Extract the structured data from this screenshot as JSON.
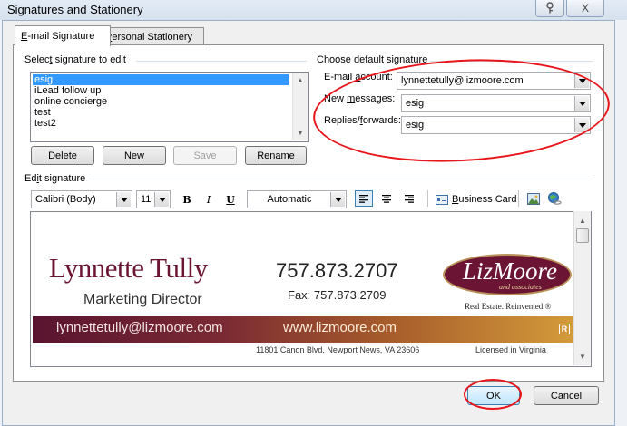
{
  "window": {
    "title": "Signatures and Stationery",
    "help_icon": "help-key-icon",
    "close_glyph": "X"
  },
  "tabs": [
    {
      "label": "E-mail Signature",
      "mnemonic": "E",
      "active": true
    },
    {
      "label": "Personal Stationery",
      "mnemonic": "P",
      "active": false
    }
  ],
  "select_signature": {
    "label": "Select signature to edit",
    "items": [
      "esig",
      "iLead follow up",
      "online concierge",
      "test",
      "test2"
    ],
    "selected_index": 0
  },
  "buttons": {
    "delete": "Delete",
    "new": "New",
    "save": "Save",
    "rename": "Rename",
    "ok": "OK",
    "cancel": "Cancel"
  },
  "defaults": {
    "label": "Choose default signature",
    "email_account_label": "E-mail account:",
    "email_account_value": "lynnettetully@lizmoore.com",
    "new_messages_label": "New messages:",
    "new_messages_value": "esig",
    "replies_label": "Replies/forwards:",
    "replies_value": "esig"
  },
  "edit": {
    "label": "Edit signature",
    "font_value": "Calibri (Body)",
    "size_value": "11",
    "bold": "B",
    "italic": "I",
    "underline": "U",
    "color_value": "Automatic",
    "business_card": "Business Card"
  },
  "signature": {
    "name": "Lynnette Tully",
    "title": "Marketing Director",
    "phone": "757.873.2707",
    "fax": "Fax: 757.873.2709",
    "email": "lynnettetully@lizmoore.com",
    "website": "www.lizmoore.com",
    "realtor_mark": "R",
    "address": "11801 Canon Blvd, Newport News, VA 23606",
    "license": "Licensed in Virginia",
    "logo_main": "LizMoore",
    "logo_sub": "and associates",
    "tagline": "Real Estate. Reinvented.®"
  },
  "colors": {
    "brand_maroon": "#6b1434",
    "annotation_red": "#e8151b",
    "selection_blue": "#3399ff"
  }
}
